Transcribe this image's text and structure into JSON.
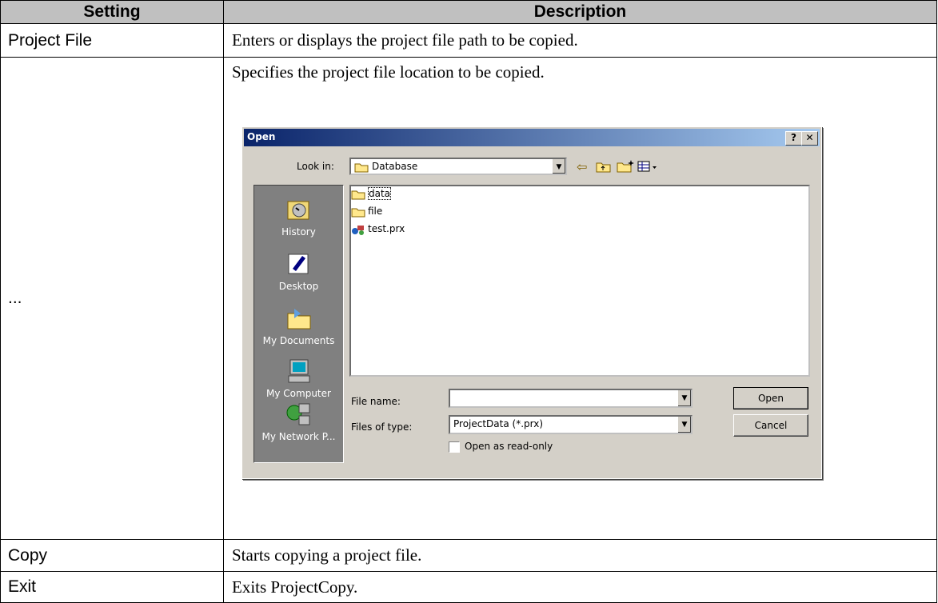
{
  "table": {
    "headers": {
      "setting": "Setting",
      "description": "Description"
    },
    "rows": [
      {
        "setting": "Project File",
        "description": "Enters or displays the project file path to be copied."
      },
      {
        "setting": "...",
        "description": "Specifies the project file location to be copied."
      },
      {
        "setting": "Copy",
        "description": "Starts copying a project file."
      },
      {
        "setting": "Exit",
        "description": "Exits ProjectCopy."
      }
    ]
  },
  "dialog": {
    "title": "Open",
    "help_btn": "?",
    "close_btn": "✕",
    "look_in_label": "Look in:",
    "look_in_value": "Database",
    "places": [
      "History",
      "Desktop",
      "My Documents",
      "My Computer",
      "My Network P..."
    ],
    "files": [
      "data",
      "file",
      "test.prx"
    ],
    "file_name_label": "File name:",
    "file_name_value": "",
    "files_of_type_label": "Files of type:",
    "files_of_type_value": "ProjectData (*.prx)",
    "open_btn": "Open",
    "cancel_btn": "Cancel",
    "readonly_label": "Open as read-only"
  }
}
